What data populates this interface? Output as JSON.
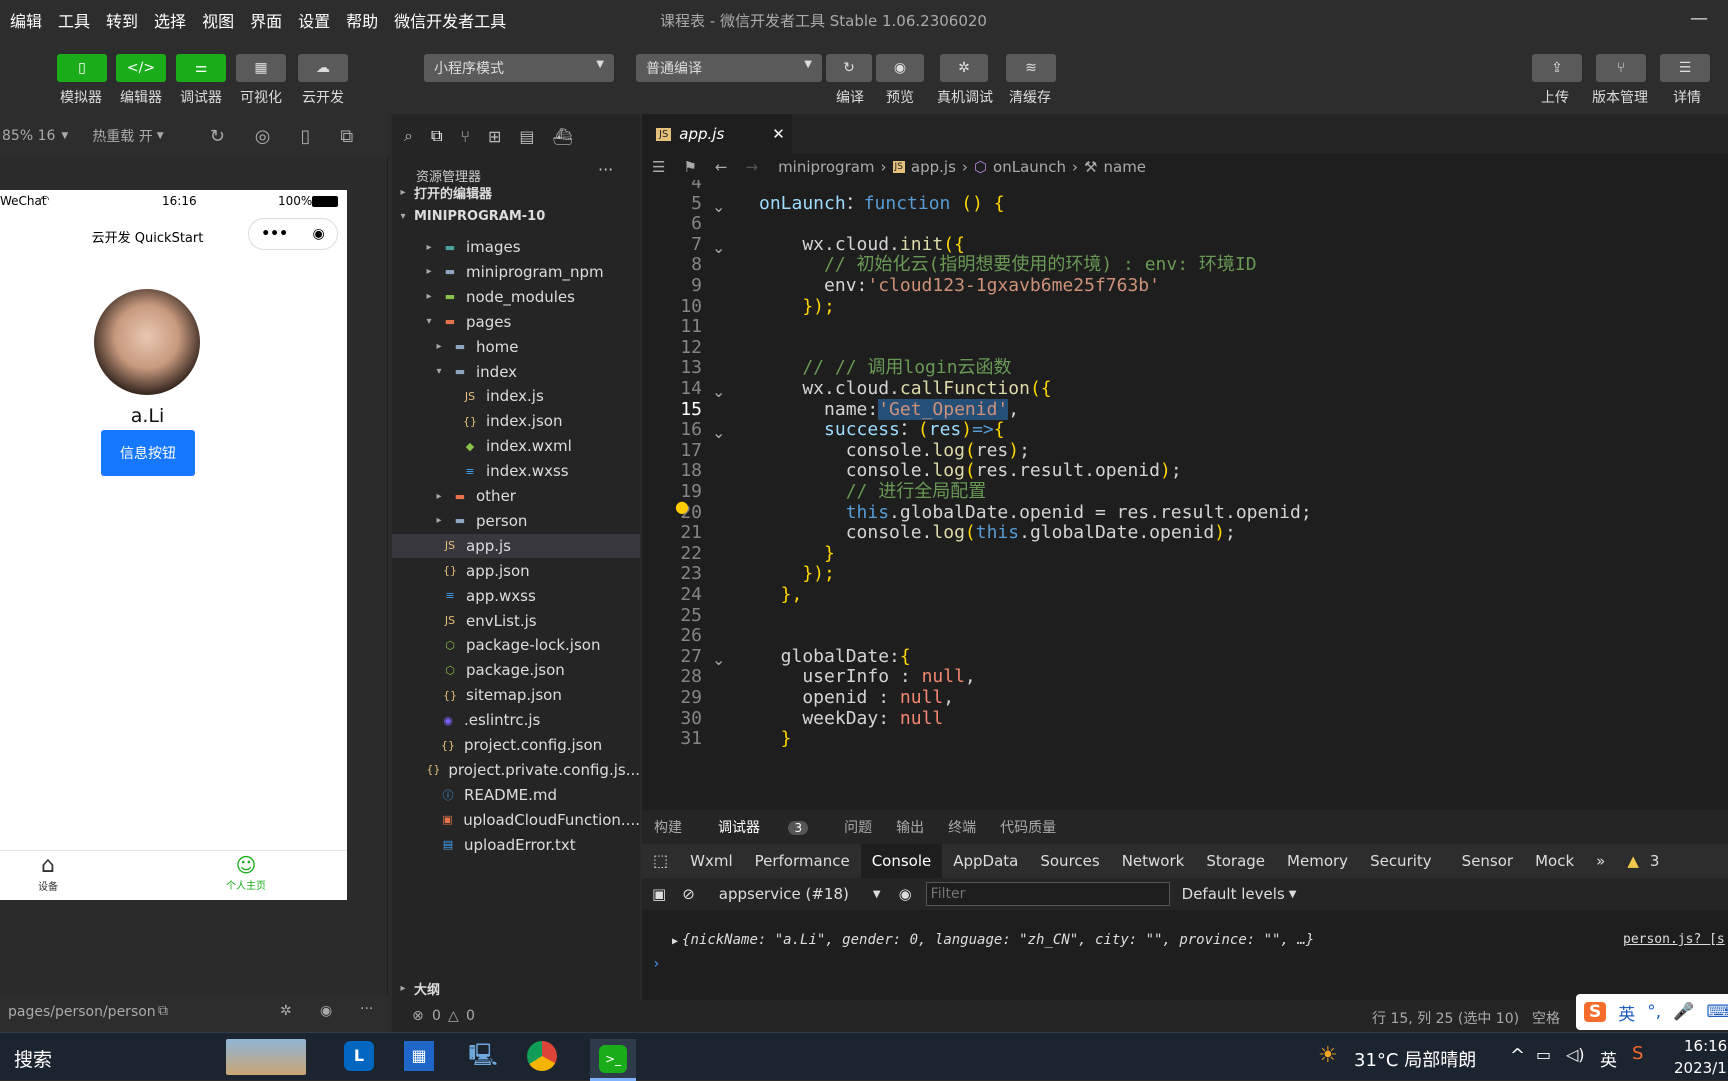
{
  "menubar": {
    "items": [
      "编辑",
      "工具",
      "转到",
      "选择",
      "视图",
      "界面",
      "设置",
      "帮助",
      "微信开发者工具"
    ],
    "title": "课程表 - 微信开发者工具 Stable 1.06.2306020"
  },
  "toolbar": {
    "left": [
      {
        "label": "模拟器"
      },
      {
        "label": "编辑器"
      },
      {
        "label": "调试器"
      },
      {
        "label": "可视化"
      },
      {
        "label": "云开发"
      }
    ],
    "mode": "小程序模式",
    "compile_mode": "普通编译",
    "actions": [
      {
        "label": "编译"
      },
      {
        "label": "预览"
      },
      {
        "label": "真机调试"
      },
      {
        "label": "清缓存"
      }
    ],
    "right": [
      {
        "label": "上传"
      },
      {
        "label": "版本管理"
      },
      {
        "label": "详情"
      }
    ]
  },
  "simulator": {
    "zoom": "85% 16",
    "hot_reload": "热重载 开",
    "status": {
      "carrier": "WeChat",
      "time": "16:16",
      "battery": "100%"
    },
    "nav_title": "云开发 QuickStart",
    "user_name": "a.Li",
    "info_button": "信息按钮",
    "tabs": [
      {
        "label": "设备"
      },
      {
        "label": "个人主页"
      }
    ],
    "page_path": "pages/person/person"
  },
  "explorer": {
    "title": "资源管理器",
    "open_editors": "打开的编辑器",
    "project": "MINIPROGRAM-10",
    "items": [
      {
        "name": "images",
        "indent": 1,
        "arrow": "▸",
        "icon": "folder-images"
      },
      {
        "name": "miniprogram_npm",
        "indent": 1,
        "arrow": "▸",
        "icon": "folder"
      },
      {
        "name": "node_modules",
        "indent": 1,
        "arrow": "▸",
        "icon": "folder-node"
      },
      {
        "name": "pages",
        "indent": 1,
        "arrow": "▾",
        "icon": "folder-pages"
      },
      {
        "name": "home",
        "indent": 2,
        "arrow": "▸",
        "icon": "folder"
      },
      {
        "name": "index",
        "indent": 2,
        "arrow": "▾",
        "icon": "folder"
      },
      {
        "name": "index.js",
        "indent": 3,
        "arrow": "",
        "icon": "js"
      },
      {
        "name": "index.json",
        "indent": 3,
        "arrow": "",
        "icon": "json"
      },
      {
        "name": "index.wxml",
        "indent": 3,
        "arrow": "",
        "icon": "wxml"
      },
      {
        "name": "index.wxss",
        "indent": 3,
        "arrow": "",
        "icon": "wxss"
      },
      {
        "name": "other",
        "indent": 2,
        "arrow": "▸",
        "icon": "folder-pages"
      },
      {
        "name": "person",
        "indent": 2,
        "arrow": "▸",
        "icon": "folder"
      },
      {
        "name": "app.js",
        "indent": 1,
        "arrow": "",
        "icon": "js",
        "selected": true
      },
      {
        "name": "app.json",
        "indent": 1,
        "arrow": "",
        "icon": "json"
      },
      {
        "name": "app.wxss",
        "indent": 1,
        "arrow": "",
        "icon": "wxss"
      },
      {
        "name": "envList.js",
        "indent": 1,
        "arrow": "",
        "icon": "js"
      },
      {
        "name": "package-lock.json",
        "indent": 1,
        "arrow": "",
        "icon": "npm"
      },
      {
        "name": "package.json",
        "indent": 1,
        "arrow": "",
        "icon": "npm"
      },
      {
        "name": "sitemap.json",
        "indent": 1,
        "arrow": "",
        "icon": "json"
      },
      {
        "name": ".eslintrc.js",
        "indent": 0,
        "arrow": "",
        "icon": "eslint"
      },
      {
        "name": "project.config.json",
        "indent": 0,
        "arrow": "",
        "icon": "json"
      },
      {
        "name": "project.private.config.js...",
        "indent": 0,
        "arrow": "",
        "icon": "json"
      },
      {
        "name": "README.md",
        "indent": 0,
        "arrow": "",
        "icon": "info"
      },
      {
        "name": "uploadCloudFunction....",
        "indent": 0,
        "arrow": "",
        "icon": "sh"
      },
      {
        "name": "uploadError.txt",
        "indent": 0,
        "arrow": "",
        "icon": "txt"
      }
    ],
    "outline": "大纲",
    "problems_errors": "0",
    "problems_warnings": "0"
  },
  "editor": {
    "tab": "app.js",
    "breadcrumb": [
      "miniprogram",
      "app.js",
      "onLaunch",
      "name"
    ],
    "lines": [
      {
        "n": "4",
        "t": []
      },
      {
        "n": "5",
        "fold": true,
        "t": [
          [
            "pr",
            "onLaunch"
          ],
          [
            "",
            "："
          ],
          [
            "kw",
            "function"
          ],
          [
            "",
            ""
          ],
          [
            "pu",
            " () {"
          ]
        ]
      },
      {
        "n": "6",
        "t": []
      },
      {
        "n": "7",
        "fold": true,
        "t": [
          [
            "",
            "    wx.cloud."
          ],
          [
            "fn",
            "init"
          ],
          [
            "pu",
            "({"
          ]
        ]
      },
      {
        "n": "8",
        "t": [
          [
            "cm",
            "      // 初始化云(指明想要使用的环境) : env: 环境ID"
          ]
        ]
      },
      {
        "n": "9",
        "t": [
          [
            "",
            "      env:"
          ],
          [
            "str",
            "'cloud123-1gxavb6me25f763b'"
          ]
        ]
      },
      {
        "n": "10",
        "t": [
          [
            "pu",
            "    });"
          ]
        ]
      },
      {
        "n": "11",
        "t": []
      },
      {
        "n": "12",
        "t": []
      },
      {
        "n": "13",
        "t": [
          [
            "cm",
            "    // // 调用login云函数"
          ]
        ]
      },
      {
        "n": "14",
        "fold": true,
        "t": [
          [
            "",
            "    wx.cloud."
          ],
          [
            "fn",
            "callFunction"
          ],
          [
            "pu",
            "({"
          ]
        ]
      },
      {
        "n": "15",
        "t": [
          [
            "",
            "      name:"
          ],
          [
            "str",
            "'Get_Openid'"
          ],
          [
            "",
            ","
          ]
        ]
      },
      {
        "n": "16",
        "fold": true,
        "t": [
          [
            "pr",
            "      success"
          ],
          [
            "",
            "："
          ],
          [
            "pu",
            "("
          ],
          [
            "pr",
            "res"
          ],
          [
            "pu",
            ")"
          ],
          [
            "kw",
            "=>"
          ],
          [
            "pu",
            "{"
          ]
        ]
      },
      {
        "n": "17",
        "t": [
          [
            "",
            "        console."
          ],
          [
            "fn",
            "log"
          ],
          [
            "pu",
            "("
          ],
          [
            "",
            "res"
          ],
          [
            "pu",
            ")"
          ],
          [
            "",
            ";"
          ]
        ]
      },
      {
        "n": "18",
        "t": [
          [
            "",
            "        console."
          ],
          [
            "fn",
            "log"
          ],
          [
            "pu",
            "("
          ],
          [
            "",
            "res.result.openid"
          ],
          [
            "pu",
            ")"
          ],
          [
            "",
            ";"
          ]
        ]
      },
      {
        "n": "19",
        "t": [
          [
            "cm",
            "        // 进行全局配置"
          ]
        ]
      },
      {
        "n": "20",
        "t": [
          [
            "kw",
            "        this"
          ],
          [
            "",
            ".globalDate.openid = res.result.openid;"
          ]
        ]
      },
      {
        "n": "21",
        "t": [
          [
            "",
            "        console."
          ],
          [
            "fn",
            "log"
          ],
          [
            "pu",
            "("
          ],
          [
            "kw",
            "this"
          ],
          [
            "",
            ".globalDate.openid"
          ],
          [
            "pu",
            ")"
          ],
          [
            "",
            ";"
          ]
        ]
      },
      {
        "n": "22",
        "t": [
          [
            "pu",
            "      }"
          ]
        ]
      },
      {
        "n": "23",
        "t": [
          [
            "pu",
            "    });"
          ]
        ]
      },
      {
        "n": "24",
        "t": [
          [
            "pu",
            "  },"
          ]
        ]
      },
      {
        "n": "25",
        "t": []
      },
      {
        "n": "26",
        "t": []
      },
      {
        "n": "27",
        "fold": true,
        "t": [
          [
            "",
            "  globalDate:"
          ],
          [
            "pu",
            "{"
          ]
        ]
      },
      {
        "n": "28",
        "t": [
          [
            "",
            "    userInfo : "
          ],
          [
            "nl",
            "null"
          ],
          [
            "",
            ","
          ]
        ]
      },
      {
        "n": "29",
        "t": [
          [
            "",
            "    openid : "
          ],
          [
            "nl",
            "null"
          ],
          [
            "",
            ","
          ]
        ]
      },
      {
        "n": "30",
        "t": [
          [
            "",
            "    weekDay: "
          ],
          [
            "nl",
            "null"
          ]
        ]
      },
      {
        "n": "31",
        "t": [
          [
            "pu",
            "  }"
          ]
        ]
      }
    ]
  },
  "debug": {
    "tabs": [
      "构建",
      "调试器",
      "问题",
      "输出",
      "终端",
      "代码质量"
    ],
    "badge": "3",
    "devtabs": [
      "Wxml",
      "Performance",
      "Console",
      "AppData",
      "Sources",
      "Network",
      "Storage",
      "Memory",
      "Security",
      "Sensor",
      "Mock"
    ],
    "warnings": "3",
    "context": "appservice (#18)",
    "filter_placeholder": "Filter",
    "levels": "Default levels",
    "log": "{nickName: \"a.Li\", gender: 0, language: \"zh_CN\", city: \"\", province: \"\", …}",
    "log_source": "person.js? [s"
  },
  "status": {
    "cursor": "行 15, 列 25 (选中 10)",
    "spaces": "空格"
  },
  "taskbar": {
    "search": "搜索",
    "weather": "31°C 局部晴朗",
    "time": "16:16",
    "date": "2023/1",
    "ime": "英"
  }
}
